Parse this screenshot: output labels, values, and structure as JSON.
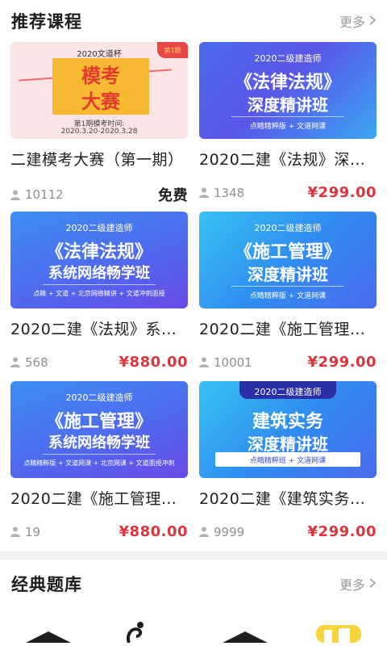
{
  "recommended": {
    "title": "推荐课程",
    "more": "更多"
  },
  "courses": [
    {
      "title": "二建模考大赛（第一期）",
      "students": "10112",
      "price": "免费",
      "thumb": {
        "style": "mock",
        "top": "2020文道杯",
        "line1": "模考",
        "line2": "大赛",
        "badge": "第1期",
        "sub1": "第1期模考时间:",
        "sub2": "2020.3.20-2020.3.28"
      }
    },
    {
      "title": "2020二建《法规》深…",
      "students": "1348",
      "price": "¥299.00",
      "thumb": {
        "style": "blue",
        "top": "2020二级建造师",
        "line1": "《法律法规》",
        "line2": "深度精讲班",
        "bar": "点睛精粹版 + 文道网课"
      }
    },
    {
      "title": "2020二建《法规》系…",
      "students": "568",
      "price": "¥880.00",
      "thumb": {
        "style": "blue2",
        "top": "2020二级建造师",
        "line1": "《法律法规》",
        "line2": "系统网络畅学班",
        "bar": "点睛 + 文道 + 北京网络精讲 + 文道冲刺面授"
      }
    },
    {
      "title": "2020二建《施工管理…",
      "students": "10001",
      "price": "¥299.00",
      "thumb": {
        "style": "cyan",
        "top": "2020二级建造师",
        "line1": "《施工管理》",
        "line2": "深度精讲班",
        "bar": "点睛精粹版 + 文道网课"
      }
    },
    {
      "title": "2020二建《施工管理…",
      "students": "19",
      "price": "¥880.00",
      "thumb": {
        "style": "blue2",
        "top": "2020二级建造师",
        "line1": "《施工管理》",
        "line2": "系统网络畅学班",
        "bar": "点睛精粹版 + 文道网课 + 北京网课 + 文道面授冲刺"
      }
    },
    {
      "title": "2020二建《建筑实务…",
      "students": "9999",
      "price": "¥299.00",
      "thumb": {
        "style": "cyan",
        "top": "2020二级建造师",
        "line1": "建筑实务",
        "line2": "深度精讲班",
        "bar": "点睛精粹班 + 文道网课"
      }
    }
  ],
  "question_bank": {
    "title": "经典题库",
    "more": "更多"
  },
  "colors": {
    "price_red": "#d9363e",
    "muted_gray": "#8f8f8f",
    "thumb_blue": "#5a56e8",
    "thumb_cyan": "#37c2f2",
    "mock_yellow": "#f7b931"
  },
  "icons": [
    "user-icon",
    "chevron-right-icon",
    "graduation-cap-icon",
    "book-icon"
  ]
}
